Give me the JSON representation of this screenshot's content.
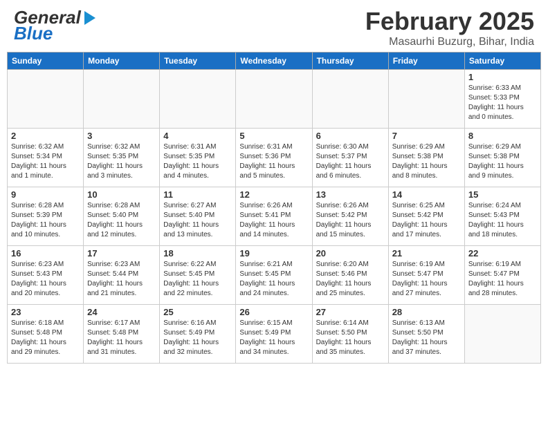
{
  "header": {
    "logo_general": "General",
    "logo_blue": "Blue",
    "main_title": "February 2025",
    "subtitle": "Masaurhi Buzurg, Bihar, India"
  },
  "calendar": {
    "days_of_week": [
      "Sunday",
      "Monday",
      "Tuesday",
      "Wednesday",
      "Thursday",
      "Friday",
      "Saturday"
    ],
    "weeks": [
      [
        {
          "day": "",
          "info": ""
        },
        {
          "day": "",
          "info": ""
        },
        {
          "day": "",
          "info": ""
        },
        {
          "day": "",
          "info": ""
        },
        {
          "day": "",
          "info": ""
        },
        {
          "day": "",
          "info": ""
        },
        {
          "day": "1",
          "info": "Sunrise: 6:33 AM\nSunset: 5:33 PM\nDaylight: 11 hours\nand 0 minutes."
        }
      ],
      [
        {
          "day": "2",
          "info": "Sunrise: 6:32 AM\nSunset: 5:34 PM\nDaylight: 11 hours\nand 1 minute."
        },
        {
          "day": "3",
          "info": "Sunrise: 6:32 AM\nSunset: 5:35 PM\nDaylight: 11 hours\nand 3 minutes."
        },
        {
          "day": "4",
          "info": "Sunrise: 6:31 AM\nSunset: 5:35 PM\nDaylight: 11 hours\nand 4 minutes."
        },
        {
          "day": "5",
          "info": "Sunrise: 6:31 AM\nSunset: 5:36 PM\nDaylight: 11 hours\nand 5 minutes."
        },
        {
          "day": "6",
          "info": "Sunrise: 6:30 AM\nSunset: 5:37 PM\nDaylight: 11 hours\nand 6 minutes."
        },
        {
          "day": "7",
          "info": "Sunrise: 6:29 AM\nSunset: 5:38 PM\nDaylight: 11 hours\nand 8 minutes."
        },
        {
          "day": "8",
          "info": "Sunrise: 6:29 AM\nSunset: 5:38 PM\nDaylight: 11 hours\nand 9 minutes."
        }
      ],
      [
        {
          "day": "9",
          "info": "Sunrise: 6:28 AM\nSunset: 5:39 PM\nDaylight: 11 hours\nand 10 minutes."
        },
        {
          "day": "10",
          "info": "Sunrise: 6:28 AM\nSunset: 5:40 PM\nDaylight: 11 hours\nand 12 minutes."
        },
        {
          "day": "11",
          "info": "Sunrise: 6:27 AM\nSunset: 5:40 PM\nDaylight: 11 hours\nand 13 minutes."
        },
        {
          "day": "12",
          "info": "Sunrise: 6:26 AM\nSunset: 5:41 PM\nDaylight: 11 hours\nand 14 minutes."
        },
        {
          "day": "13",
          "info": "Sunrise: 6:26 AM\nSunset: 5:42 PM\nDaylight: 11 hours\nand 15 minutes."
        },
        {
          "day": "14",
          "info": "Sunrise: 6:25 AM\nSunset: 5:42 PM\nDaylight: 11 hours\nand 17 minutes."
        },
        {
          "day": "15",
          "info": "Sunrise: 6:24 AM\nSunset: 5:43 PM\nDaylight: 11 hours\nand 18 minutes."
        }
      ],
      [
        {
          "day": "16",
          "info": "Sunrise: 6:23 AM\nSunset: 5:43 PM\nDaylight: 11 hours\nand 20 minutes."
        },
        {
          "day": "17",
          "info": "Sunrise: 6:23 AM\nSunset: 5:44 PM\nDaylight: 11 hours\nand 21 minutes."
        },
        {
          "day": "18",
          "info": "Sunrise: 6:22 AM\nSunset: 5:45 PM\nDaylight: 11 hours\nand 22 minutes."
        },
        {
          "day": "19",
          "info": "Sunrise: 6:21 AM\nSunset: 5:45 PM\nDaylight: 11 hours\nand 24 minutes."
        },
        {
          "day": "20",
          "info": "Sunrise: 6:20 AM\nSunset: 5:46 PM\nDaylight: 11 hours\nand 25 minutes."
        },
        {
          "day": "21",
          "info": "Sunrise: 6:19 AM\nSunset: 5:47 PM\nDaylight: 11 hours\nand 27 minutes."
        },
        {
          "day": "22",
          "info": "Sunrise: 6:19 AM\nSunset: 5:47 PM\nDaylight: 11 hours\nand 28 minutes."
        }
      ],
      [
        {
          "day": "23",
          "info": "Sunrise: 6:18 AM\nSunset: 5:48 PM\nDaylight: 11 hours\nand 29 minutes."
        },
        {
          "day": "24",
          "info": "Sunrise: 6:17 AM\nSunset: 5:48 PM\nDaylight: 11 hours\nand 31 minutes."
        },
        {
          "day": "25",
          "info": "Sunrise: 6:16 AM\nSunset: 5:49 PM\nDaylight: 11 hours\nand 32 minutes."
        },
        {
          "day": "26",
          "info": "Sunrise: 6:15 AM\nSunset: 5:49 PM\nDaylight: 11 hours\nand 34 minutes."
        },
        {
          "day": "27",
          "info": "Sunrise: 6:14 AM\nSunset: 5:50 PM\nDaylight: 11 hours\nand 35 minutes."
        },
        {
          "day": "28",
          "info": "Sunrise: 6:13 AM\nSunset: 5:50 PM\nDaylight: 11 hours\nand 37 minutes."
        },
        {
          "day": "",
          "info": ""
        }
      ]
    ]
  }
}
